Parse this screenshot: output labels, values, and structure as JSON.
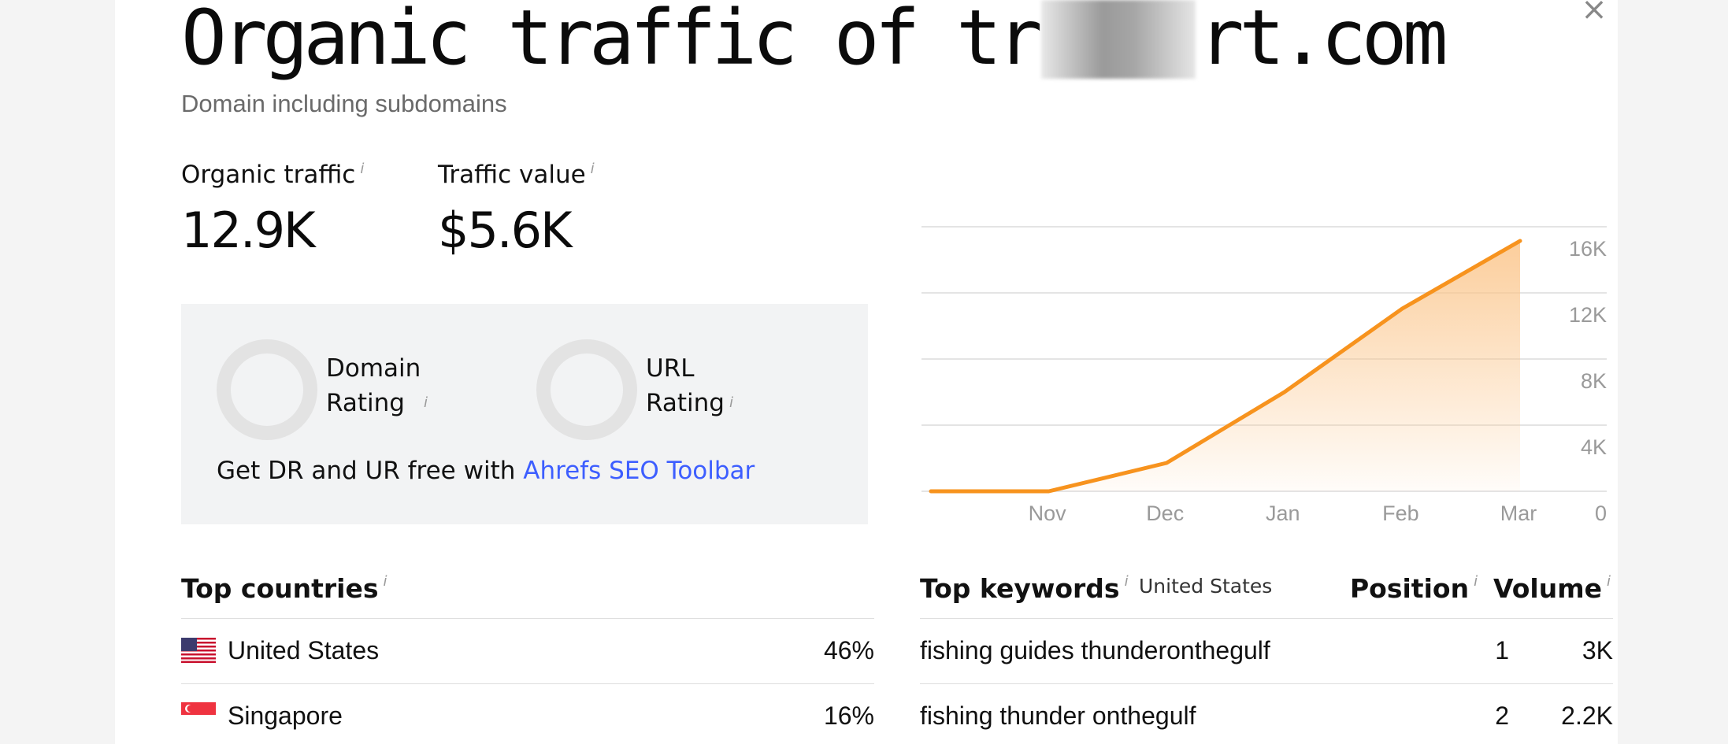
{
  "modal": {
    "title_before": "Organic traffic of tr",
    "title_after": "rt.com",
    "subtitle": "Domain including subdomains",
    "close_label": "×"
  },
  "metrics": {
    "organic_traffic": {
      "label": "Organic traffic",
      "value": "12.9K"
    },
    "traffic_value": {
      "label": "Traffic value",
      "value": "$5.6K"
    },
    "info_glyph": "i"
  },
  "ratings": {
    "domain_rating": {
      "line1": "Domain",
      "line2": "Rating"
    },
    "url_rating": {
      "line1": "URL",
      "line2": "Rating"
    },
    "promo_text": "Get DR and UR free with ",
    "promo_link": "Ahrefs SEO Toolbar"
  },
  "chart_data": {
    "type": "area",
    "x": [
      "",
      "Nov",
      "Dec",
      "Jan",
      "Feb",
      "Mar"
    ],
    "values": [
      0,
      0,
      1800,
      6300,
      11600,
      15900
    ],
    "y_ticks": [
      "16K",
      "12K",
      "8K",
      "4K",
      "0"
    ],
    "ylim": [
      0,
      16000
    ],
    "grid": true,
    "colors": {
      "line": "#f7931e",
      "fill": "#fbc58a"
    }
  },
  "top_countries": {
    "title": "Top countries",
    "rows": [
      {
        "country": "United States",
        "share": "46%",
        "flag": "us-flag"
      },
      {
        "country": "Singapore",
        "share": "16%",
        "flag": "sg-flag"
      }
    ]
  },
  "top_keywords": {
    "title": "Top keywords",
    "country": "United States",
    "col_position": "Position",
    "col_volume": "Volume",
    "rows": [
      {
        "keyword": "fishing guides thunderonthegulf",
        "position": "1",
        "volume": "3K"
      },
      {
        "keyword": "fishing thunder onthegulf",
        "position": "2",
        "volume": "2.2K"
      }
    ]
  }
}
